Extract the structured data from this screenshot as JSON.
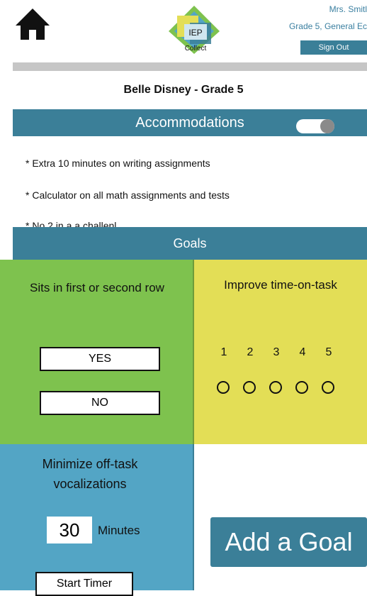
{
  "header": {
    "home_icon": "home-icon",
    "logo_text_top": "IEP",
    "logo_text_bottom": "Collect",
    "teacher_name": "Mrs. Smitl",
    "teacher_class": "Grade 5, General Ec",
    "sign_out_label": "Sign Out"
  },
  "student": {
    "title": "Belle Disney - Grade 5"
  },
  "accommodations": {
    "title": "Accommodations",
    "toggle_on": true,
    "items": [
      "* Extra 10 minutes on writing assignments",
      "* Calculator on all math assignments and tests",
      "* No 2 in a a challenl"
    ]
  },
  "goals": {
    "title": "Goals",
    "goal1": {
      "title": "Sits in first or second row",
      "yes_label": "YES",
      "no_label": "NO"
    },
    "goal2": {
      "title": "Improve time-on-task",
      "scale": [
        "1",
        "2",
        "3",
        "4",
        "5"
      ]
    },
    "goal3": {
      "title": "Minimize off-task vocalizations",
      "minutes_value": "30",
      "minutes_label": "Minutes",
      "start_timer_label": "Start Timer"
    },
    "add_goal_label": "Add a Goal"
  },
  "colors": {
    "accent": "#3b7f98",
    "goal_green": "#7ec24e",
    "goal_yellow": "#e3de56",
    "goal_blue": "#53a5c5"
  }
}
